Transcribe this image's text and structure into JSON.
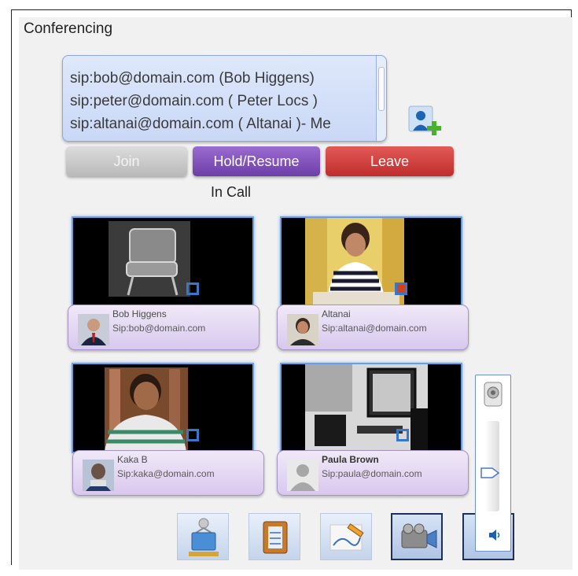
{
  "window": {
    "title": "Conferencing"
  },
  "participants_list": [
    "sip:bob@domain.com (Bob Higgens)",
    "sip:peter@domain.com ( Peter Locs )",
    "sip:altanai@domain.com ( Altanai )- Me"
  ],
  "buttons": {
    "join": "Join",
    "hold": "Hold/Resume",
    "leave": "Leave"
  },
  "status": "In Call",
  "video_tiles": [
    {
      "name": "Bob Higgens",
      "sip": "Sip:bob@domain.com"
    },
    {
      "name": "Altanai",
      "sip": "Sip:altanai@domain.com"
    },
    {
      "name": "Kaka B",
      "sip": "Sip:kaka@domain.com"
    },
    {
      "name": "Paula Brown",
      "sip": "Sip:paula@domain.com"
    }
  ],
  "toolbar_icons": [
    "conference-icon",
    "notes-icon",
    "whiteboard-icon",
    "video-camera-icon",
    "volume-icon"
  ],
  "volume": {
    "level": 0.42
  },
  "colors": {
    "join": "#c9c9c9",
    "hold": "#7f4fbc",
    "leave": "#d23f3d",
    "tile_border": "#6a9ee3",
    "card": "#e4d8f2"
  }
}
